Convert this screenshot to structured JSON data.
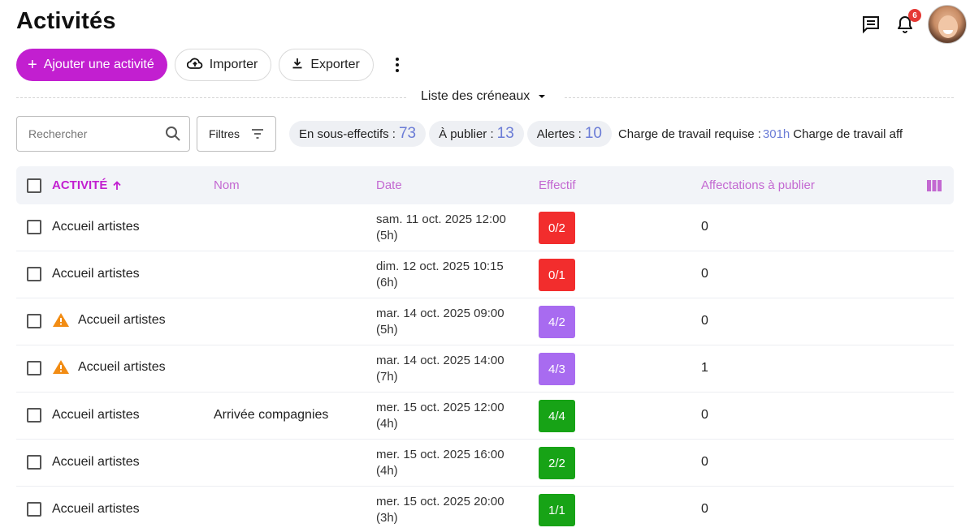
{
  "page": {
    "title": "Activités"
  },
  "header": {
    "notification_count": "6"
  },
  "toolbar": {
    "add_label": "Ajouter une activité",
    "import_label": "Importer",
    "export_label": "Exporter"
  },
  "view": {
    "selector_label": "Liste des créneaux"
  },
  "filters": {
    "search_placeholder": "Rechercher",
    "filters_label": "Filtres",
    "chips": [
      {
        "label": "En sous-effectifs :",
        "value": "73"
      },
      {
        "label": "À publier :",
        "value": "13"
      },
      {
        "label": "Alertes :",
        "value": "10"
      }
    ],
    "workload_required_label": "Charge de travail requise :",
    "workload_required_value": "301h",
    "workload_assigned_label": "Charge de travail aff"
  },
  "table": {
    "columns": {
      "activity": "ACTIVITÉ",
      "name": "Nom",
      "date": "Date",
      "staff": "Effectif",
      "to_publish": "Affectations à publier"
    },
    "rows": [
      {
        "activity": "Accueil artistes",
        "warning": false,
        "name": "",
        "date_line1": "sam. 11 oct. 2025 12:00",
        "date_line2": "(5h)",
        "staff": "0/2",
        "staff_status": "under",
        "to_publish": "0"
      },
      {
        "activity": "Accueil artistes",
        "warning": false,
        "name": "",
        "date_line1": "dim. 12 oct. 2025 10:15",
        "date_line2": "(6h)",
        "staff": "0/1",
        "staff_status": "under",
        "to_publish": "0"
      },
      {
        "activity": "Accueil artistes",
        "warning": true,
        "name": "",
        "date_line1": "mar. 14 oct. 2025 09:00",
        "date_line2": "(5h)",
        "staff": "4/2",
        "staff_status": "over",
        "to_publish": "0"
      },
      {
        "activity": "Accueil artistes",
        "warning": true,
        "name": "",
        "date_line1": "mar. 14 oct. 2025 14:00",
        "date_line2": "(7h)",
        "staff": "4/3",
        "staff_status": "over",
        "to_publish": "1"
      },
      {
        "activity": "Accueil artistes",
        "warning": false,
        "name": "Arrivée compagnies",
        "date_line1": "mer. 15 oct. 2025 12:00",
        "date_line2": "(4h)",
        "staff": "4/4",
        "staff_status": "full",
        "to_publish": "0"
      },
      {
        "activity": "Accueil artistes",
        "warning": false,
        "name": "",
        "date_line1": "mer. 15 oct. 2025 16:00",
        "date_line2": "(4h)",
        "staff": "2/2",
        "staff_status": "full",
        "to_publish": "0"
      },
      {
        "activity": "Accueil artistes",
        "warning": false,
        "name": "",
        "date_line1": "mer. 15 oct. 2025 20:00",
        "date_line2": "(3h)",
        "staff": "1/1",
        "staff_status": "full",
        "to_publish": "0"
      }
    ]
  },
  "colors": {
    "accent": "#c21fd0",
    "under": "#f22d2d",
    "over": "#a86bf0",
    "full": "#17a316",
    "count": "#6b7cd6",
    "warning": "#f28c13"
  }
}
